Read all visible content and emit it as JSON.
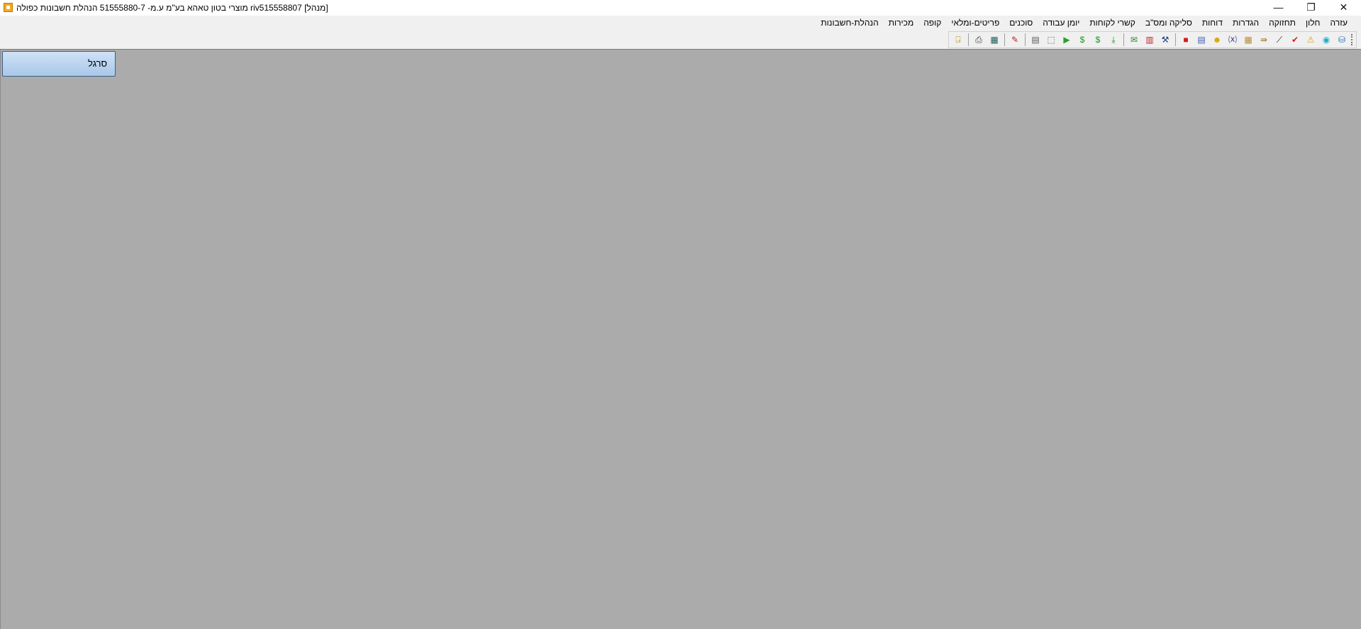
{
  "window": {
    "title": "מוצרי בטון טאהא בע\"מ ע.מ- 51555880-7 הנהלת חשבונות כפולה riv515558807 [מנהל]",
    "controls": {
      "minimize": "—",
      "restore": "❐",
      "close": "✕"
    }
  },
  "menu": {
    "items": [
      "הנהלת-חשבונות",
      "מכירות",
      "קופה",
      "פריטים-ומלאי",
      "סוכנים",
      "יומן עבודה",
      "קשרי לקוחות",
      "סליקה ומס\"ב",
      "דוחות",
      "הגדרות",
      "תחזוקה",
      "חלון",
      "עזרה"
    ]
  },
  "toolbar": {
    "icons": [
      {
        "name": "database-icon",
        "glyph": "⛁",
        "color": "#1a6fb5"
      },
      {
        "name": "globe-icon",
        "glyph": "◉",
        "color": "#1ab0c8"
      },
      {
        "name": "warning-icon",
        "glyph": "⚠",
        "color": "#d9a400"
      },
      {
        "name": "checkmark-icon",
        "glyph": "✔",
        "color": "#d41c1c"
      },
      {
        "name": "telescope-icon",
        "glyph": "⟋",
        "color": "#222222"
      },
      {
        "name": "arrow-import-icon",
        "glyph": "⇛",
        "color": "#a07a2a"
      },
      {
        "name": "calendar-icon",
        "glyph": "▦",
        "color": "#b58a3a"
      },
      {
        "name": "formula-icon",
        "glyph": "⒳",
        "color": "#3a3a8a"
      },
      {
        "name": "user-icon",
        "glyph": "☻",
        "color": "#d9a400"
      },
      {
        "name": "report-icon",
        "glyph": "▤",
        "color": "#3a5ab5"
      },
      {
        "name": "stop-icon",
        "glyph": "■",
        "color": "#d41c1c"
      },
      {
        "name": "tools-icon",
        "glyph": "⚒",
        "color": "#1a3a8a"
      },
      {
        "name": "chart-icon",
        "glyph": "▥",
        "color": "#c81c1c"
      },
      {
        "name": "email-icon",
        "glyph": "✉",
        "color": "#2a8a2a"
      },
      {
        "name": "download-icon",
        "glyph": "⤓",
        "color": "#1a9a1a"
      },
      {
        "name": "money-bag-icon",
        "glyph": "$",
        "color": "#1a9a1a"
      },
      {
        "name": "money-bag-2-icon",
        "glyph": "$",
        "color": "#1a9a1a"
      },
      {
        "name": "play-icon",
        "glyph": "▶",
        "color": "#2aa02a"
      },
      {
        "name": "select-icon",
        "glyph": "⬚",
        "color": "#555555"
      },
      {
        "name": "document-icon",
        "glyph": "▤",
        "color": "#555555"
      },
      {
        "name": "edit-icon",
        "glyph": "✎",
        "color": "#c81c1c"
      },
      {
        "name": "calculator-icon",
        "glyph": "▦",
        "color": "#1a5a5a"
      },
      {
        "name": "print-icon",
        "glyph": "⎙",
        "color": "#333333"
      },
      {
        "name": "exit-icon",
        "glyph": "⍈",
        "color": "#b58a00"
      }
    ],
    "separators_after": [
      10,
      13,
      19,
      20,
      22
    ]
  },
  "workspace": {
    "sargel_label": "סרגל"
  }
}
